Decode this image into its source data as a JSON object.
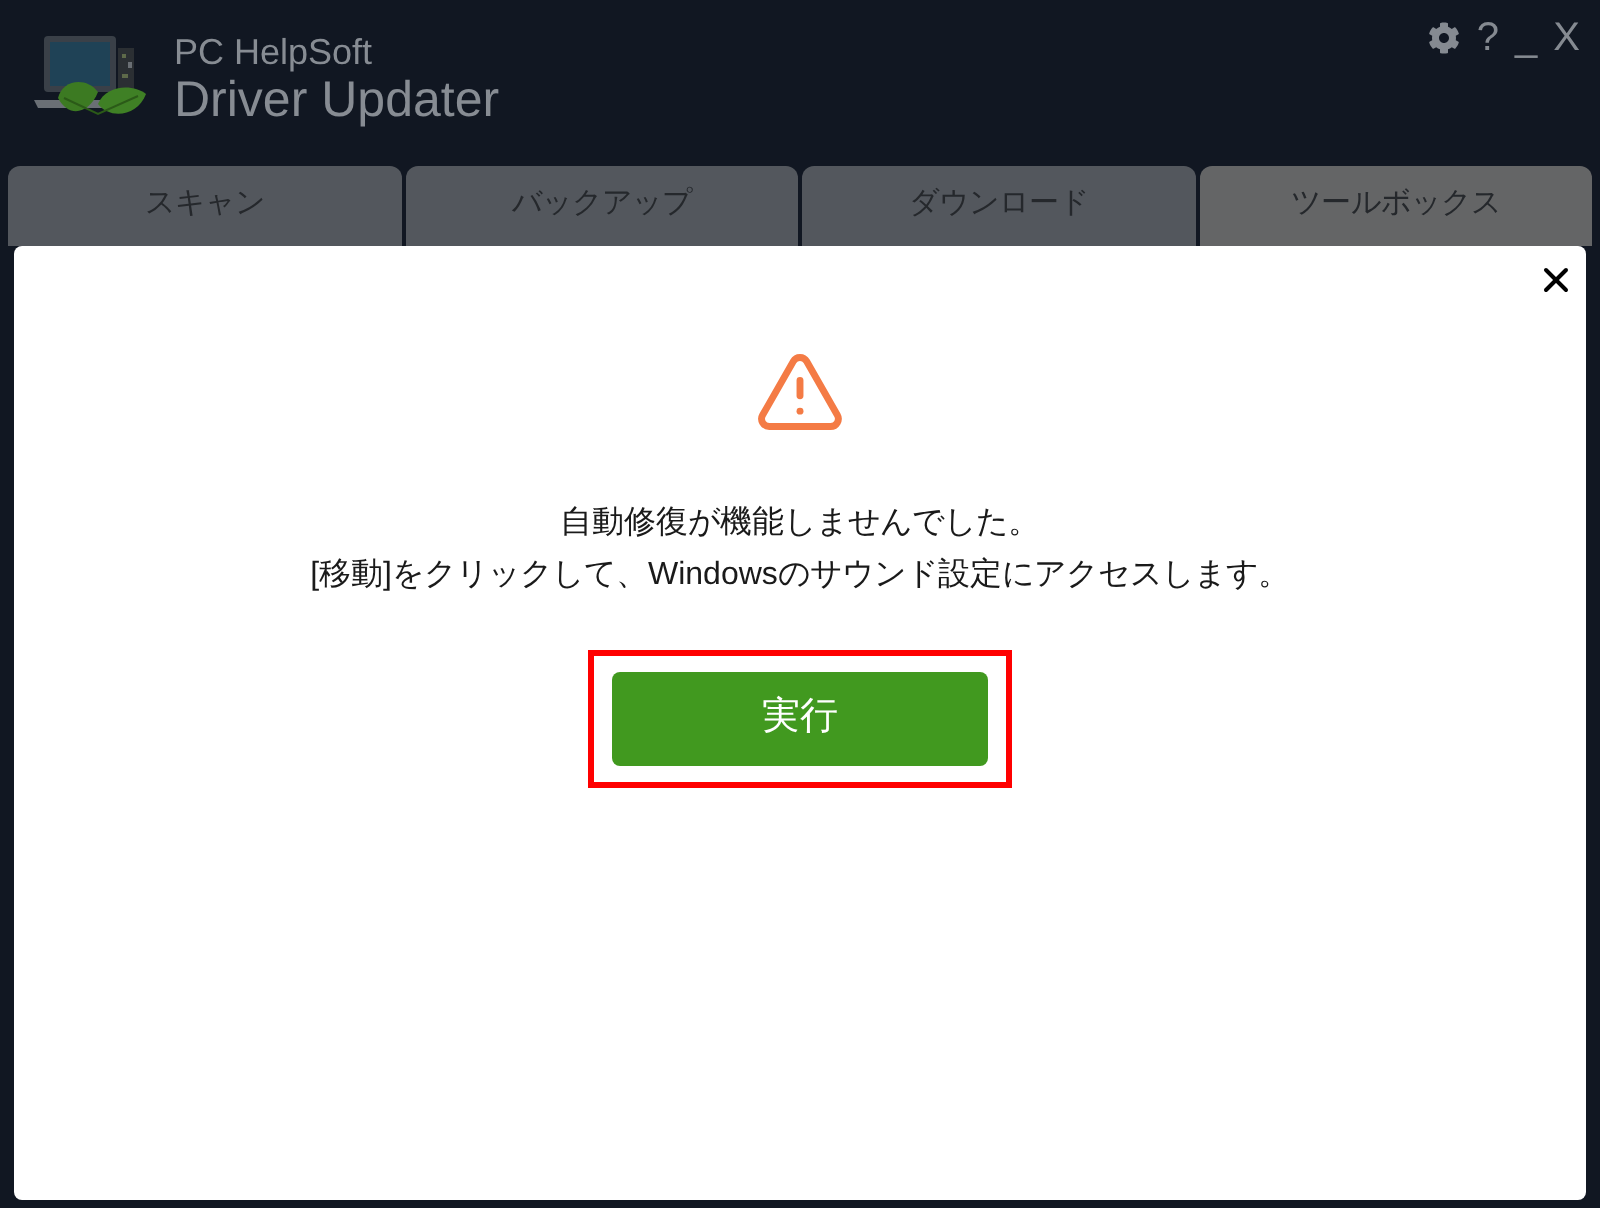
{
  "app": {
    "brand": "PC HelpSoft",
    "product": "Driver Updater"
  },
  "window_controls": [
    {
      "kind": "settings"
    },
    {
      "kind": "text",
      "label": "?"
    },
    {
      "kind": "text",
      "label": "_"
    },
    {
      "kind": "text",
      "label": "X"
    }
  ],
  "tabs": [
    {
      "label": "スキャン",
      "selected": false
    },
    {
      "label": "バックアップ",
      "selected": false
    },
    {
      "label": "ダウンロード",
      "selected": false
    },
    {
      "label": "ツールボックス",
      "selected": true
    }
  ],
  "dialog": {
    "message": [
      "自動修復が機能しませんでした。",
      "[移動]をクリックして、Windowsのサウンド設定にアクセスします。"
    ],
    "button": {
      "label": "実行",
      "highlighted": true
    }
  }
}
